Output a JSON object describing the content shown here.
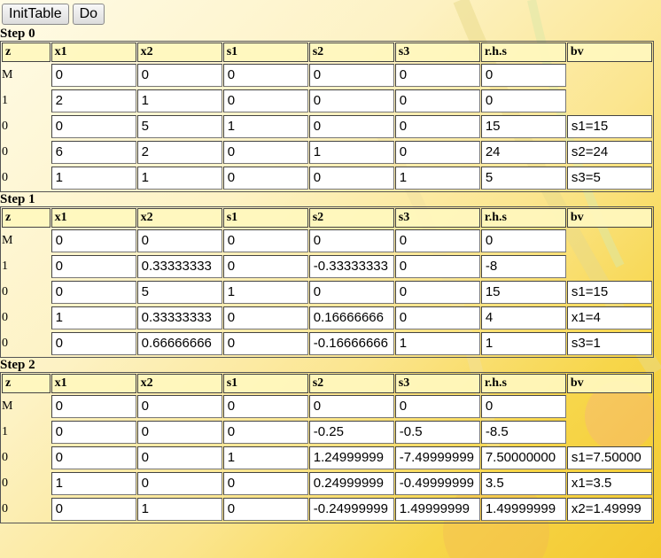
{
  "buttons": {
    "init": "InitTable",
    "do": "Do"
  },
  "columns": [
    "z",
    "x1",
    "x2",
    "s1",
    "s2",
    "s3",
    "r.h.s",
    "bv"
  ],
  "steps": [
    {
      "title": "Step 0",
      "rows": [
        {
          "z": "M",
          "vals": [
            "0",
            "0",
            "0",
            "0",
            "0",
            "0"
          ],
          "bv": ""
        },
        {
          "z": "1",
          "vals": [
            "2",
            "1",
            "0",
            "0",
            "0",
            "0"
          ],
          "bv": ""
        },
        {
          "z": "0",
          "vals": [
            "0",
            "5",
            "1",
            "0",
            "0",
            "15"
          ],
          "bv": "s1=15"
        },
        {
          "z": "0",
          "vals": [
            "6",
            "2",
            "0",
            "1",
            "0",
            "24"
          ],
          "bv": "s2=24"
        },
        {
          "z": "0",
          "vals": [
            "1",
            "1",
            "0",
            "0",
            "1",
            "5"
          ],
          "bv": "s3=5"
        }
      ]
    },
    {
      "title": "Step 1",
      "rows": [
        {
          "z": "M",
          "vals": [
            "0",
            "0",
            "0",
            "0",
            "0",
            "0"
          ],
          "bv": ""
        },
        {
          "z": "1",
          "vals": [
            "0",
            "0.33333333",
            "0",
            "-0.33333333",
            "0",
            "-8"
          ],
          "bv": ""
        },
        {
          "z": "0",
          "vals": [
            "0",
            "5",
            "1",
            "0",
            "0",
            "15"
          ],
          "bv": "s1=15"
        },
        {
          "z": "0",
          "vals": [
            "1",
            "0.33333333",
            "0",
            "0.16666666",
            "0",
            "4"
          ],
          "bv": "x1=4"
        },
        {
          "z": "0",
          "vals": [
            "0",
            "0.66666666",
            "0",
            "-0.16666666",
            "1",
            "1"
          ],
          "bv": "s3=1"
        }
      ]
    },
    {
      "title": "Step 2",
      "rows": [
        {
          "z": "M",
          "vals": [
            "0",
            "0",
            "0",
            "0",
            "0",
            "0"
          ],
          "bv": ""
        },
        {
          "z": "1",
          "vals": [
            "0",
            "0",
            "0",
            "-0.25",
            "-0.5",
            "-8.5"
          ],
          "bv": ""
        },
        {
          "z": "0",
          "vals": [
            "0",
            "0",
            "1",
            "1.24999999",
            "-7.49999999",
            "7.50000000"
          ],
          "bv": "s1=7.50000"
        },
        {
          "z": "0",
          "vals": [
            "1",
            "0",
            "0",
            "0.24999999",
            "-0.49999999",
            "3.5"
          ],
          "bv": "x1=3.5"
        },
        {
          "z": "0",
          "vals": [
            "0",
            "1",
            "0",
            "-0.24999999",
            "1.49999999",
            "1.49999999"
          ],
          "bv": "x2=1.49999"
        }
      ]
    }
  ]
}
